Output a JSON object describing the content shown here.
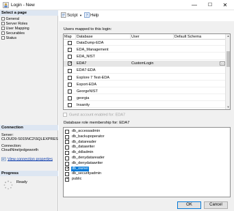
{
  "window": {
    "title": "Login - New",
    "minimize": "—",
    "maximize": "☐",
    "close": "✕"
  },
  "left_pane": {
    "select_page_header": "Select a page",
    "pages": [
      "General",
      "Server Roles",
      "User Mapping",
      "Securables",
      "Status"
    ],
    "connection_header": "Connection",
    "server_label": "Server:",
    "server_value": "CLOUD9-S015NC2\\SQLEXPRES",
    "connection_label": "Connection:",
    "connection_value": "CloudNine\\jedgeworth",
    "view_connection_properties": "View connection properties",
    "progress_header": "Progress",
    "progress_status": "Ready"
  },
  "toolbar": {
    "script_label": "Script",
    "help_label": "Help"
  },
  "user_mapping": {
    "label": "Users mapped to this login:",
    "columns": [
      "Map",
      "Database",
      "User",
      "Default Schema"
    ],
    "rows": [
      {
        "map": false,
        "database": "DataDump-EDA",
        "user": "",
        "schema": ""
      },
      {
        "map": false,
        "database": "EDA_Management",
        "user": "",
        "schema": ""
      },
      {
        "map": false,
        "database": "EDA_NIST",
        "user": "",
        "schema": ""
      },
      {
        "map": true,
        "database": "EDA7",
        "user": "CustomLogin",
        "schema": "",
        "selected": true
      },
      {
        "map": false,
        "database": "EDA7-EDA",
        "user": "",
        "schema": ""
      },
      {
        "map": false,
        "database": "Explore 7 Test-EDA",
        "user": "",
        "schema": ""
      },
      {
        "map": false,
        "database": "Export-EDA",
        "user": "",
        "schema": ""
      },
      {
        "map": false,
        "database": "GeorgeNIST",
        "user": "",
        "schema": ""
      },
      {
        "map": false,
        "database": "georgia",
        "user": "",
        "schema": ""
      },
      {
        "map": false,
        "database": "Insanity",
        "user": "",
        "schema": ""
      }
    ],
    "ellipsis": "..."
  },
  "guest_account": {
    "label": "Guest account enabled for: EDA7",
    "checked": false
  },
  "role_membership": {
    "label": "Database role membership for: EDA7",
    "roles": [
      {
        "name": "db_accessadmin",
        "checked": false
      },
      {
        "name": "db_backupoperator",
        "checked": false
      },
      {
        "name": "db_datareader",
        "checked": false
      },
      {
        "name": "db_datawriter",
        "checked": false
      },
      {
        "name": "db_ddladmin",
        "checked": false
      },
      {
        "name": "db_denydatareader",
        "checked": false
      },
      {
        "name": "db_denydatawriter",
        "checked": false
      },
      {
        "name": "db_owner",
        "checked": true,
        "selected": true
      },
      {
        "name": "db_securityadmin",
        "checked": false
      },
      {
        "name": "public",
        "checked": true
      }
    ]
  },
  "buttons": {
    "ok": "OK",
    "cancel": "Cancel"
  },
  "colors": {
    "selection": "#0078d7",
    "header_band": "#dde6f2",
    "link": "#0033aa"
  }
}
